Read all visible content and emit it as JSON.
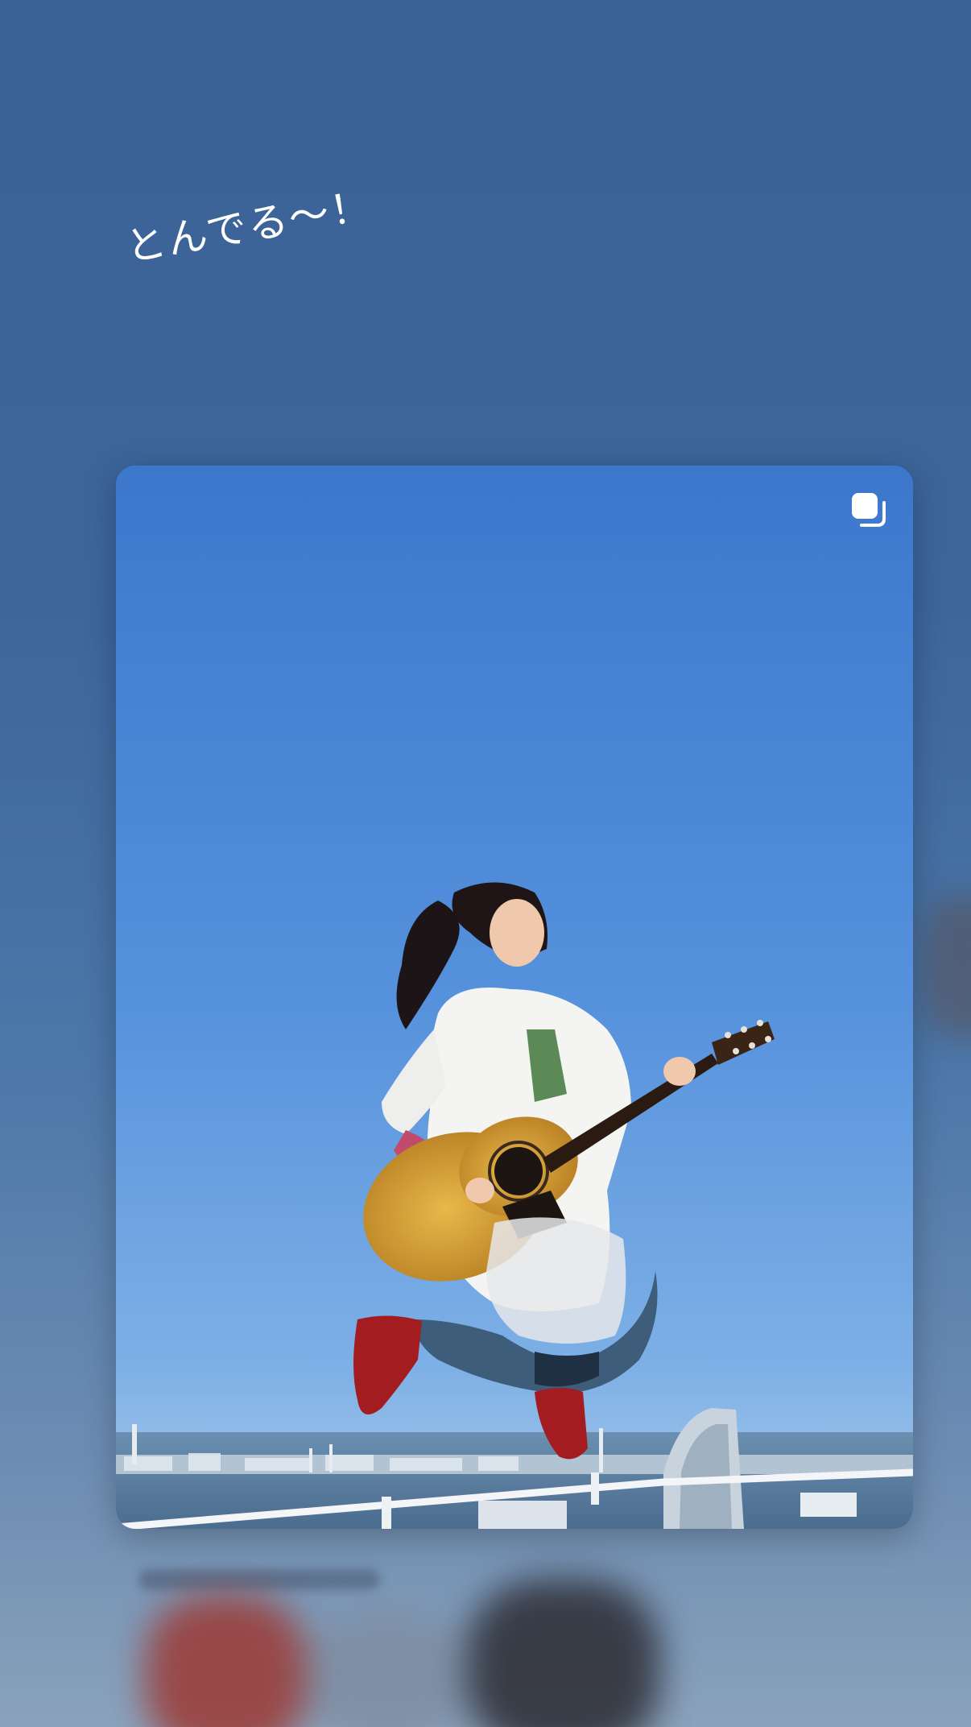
{
  "story": {
    "caption": "とんでる〜！"
  },
  "post": {
    "media_type": "carousel",
    "carousel_icon": "carousel-multiple-icon"
  },
  "colors": {
    "background_top": "#3b6296",
    "background_bottom": "#8aa2bb",
    "sky": "#4f8ad9",
    "caption_text": "#ffffff"
  }
}
